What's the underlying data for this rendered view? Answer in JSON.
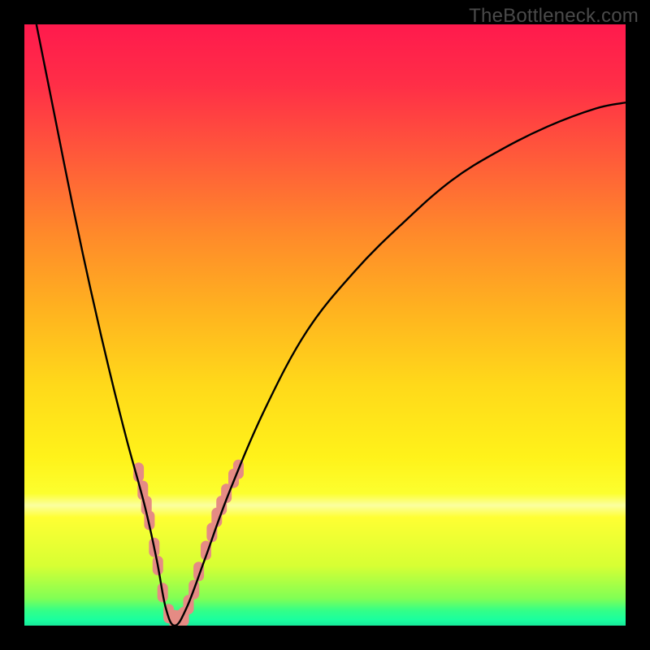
{
  "watermark": "TheBottleneck.com",
  "chart_data": {
    "type": "line",
    "title": "",
    "xlabel": "",
    "ylabel": "",
    "xlim": [
      0,
      100
    ],
    "ylim": [
      0,
      100
    ],
    "series": [
      {
        "name": "bottleneck-curve",
        "type": "line",
        "color": "#000000",
        "x": [
          2,
          5,
          8,
          11,
          14,
          17,
          20,
          22,
          23.5,
          25,
          27,
          30,
          34,
          40,
          47,
          55,
          63,
          71,
          79,
          87,
          95,
          100
        ],
        "y": [
          100,
          85,
          70,
          56,
          43,
          31,
          20,
          11,
          3,
          0,
          3,
          11,
          22,
          36,
          49,
          59,
          67,
          74,
          79,
          83,
          86,
          87
        ]
      },
      {
        "name": "marker-cluster-left",
        "type": "marker",
        "color": "#e58b84",
        "points": [
          {
            "x": 19.0,
            "y": 25.5
          },
          {
            "x": 19.7,
            "y": 22.5
          },
          {
            "x": 20.3,
            "y": 20.0
          },
          {
            "x": 20.8,
            "y": 17.5
          },
          {
            "x": 21.6,
            "y": 13.0
          },
          {
            "x": 22.2,
            "y": 10.0
          },
          {
            "x": 23.0,
            "y": 5.5
          },
          {
            "x": 24.0,
            "y": 2.0
          },
          {
            "x": 25.0,
            "y": 1.0
          },
          {
            "x": 25.8,
            "y": 1.0
          },
          {
            "x": 26.5,
            "y": 1.5
          }
        ]
      },
      {
        "name": "marker-cluster-right",
        "type": "marker",
        "color": "#e58b84",
        "points": [
          {
            "x": 27.3,
            "y": 3.5
          },
          {
            "x": 28.2,
            "y": 6.0
          },
          {
            "x": 29.0,
            "y": 9.0
          },
          {
            "x": 30.2,
            "y": 12.5
          },
          {
            "x": 31.2,
            "y": 15.5
          },
          {
            "x": 32.0,
            "y": 18.0
          },
          {
            "x": 32.8,
            "y": 20.0
          },
          {
            "x": 33.6,
            "y": 22.0
          },
          {
            "x": 34.8,
            "y": 24.5
          },
          {
            "x": 35.6,
            "y": 26.0
          }
        ]
      }
    ],
    "background_gradient": {
      "stops": [
        {
          "pos": 0.0,
          "color": "#ff1a4d"
        },
        {
          "pos": 0.1,
          "color": "#ff2e47"
        },
        {
          "pos": 0.22,
          "color": "#ff5a3a"
        },
        {
          "pos": 0.35,
          "color": "#ff8a2a"
        },
        {
          "pos": 0.48,
          "color": "#ffb41f"
        },
        {
          "pos": 0.6,
          "color": "#ffd91a"
        },
        {
          "pos": 0.72,
          "color": "#fff21a"
        },
        {
          "pos": 0.78,
          "color": "#fcff2e"
        },
        {
          "pos": 0.8,
          "color": "#fbffa0"
        },
        {
          "pos": 0.82,
          "color": "#ffff33"
        },
        {
          "pos": 0.9,
          "color": "#d7ff33"
        },
        {
          "pos": 0.955,
          "color": "#80ff55"
        },
        {
          "pos": 0.975,
          "color": "#33ff88"
        },
        {
          "pos": 0.99,
          "color": "#1aff9e"
        },
        {
          "pos": 1.0,
          "color": "#17e89a"
        }
      ]
    }
  }
}
